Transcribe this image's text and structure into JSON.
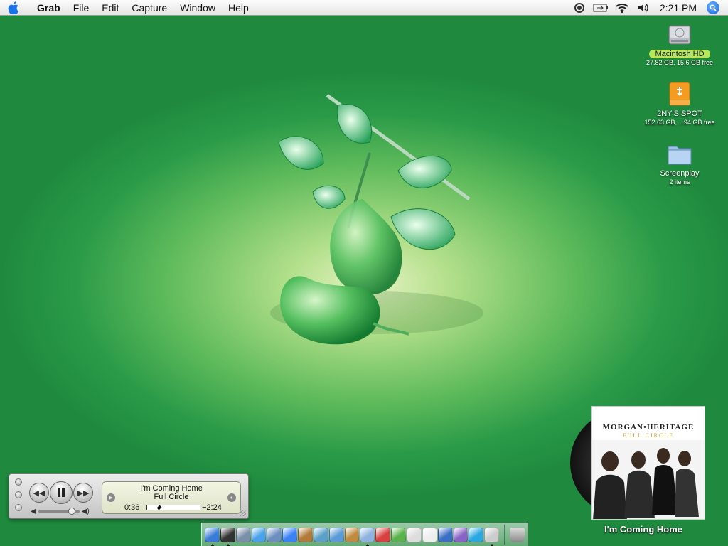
{
  "menubar": {
    "app_name": "Grab",
    "items": [
      "File",
      "Edit",
      "Capture",
      "Window",
      "Help"
    ],
    "clock": "2:21 PM"
  },
  "desktop_icons": [
    {
      "name": "Macintosh HD",
      "sub": "27.82 GB, 15.6 GB free",
      "icon": "hard-drive-icon",
      "selected": true
    },
    {
      "name": "2NY'S SPOT",
      "sub": "152.63 GB, ...94 GB free",
      "icon": "external-drive-icon",
      "selected": false
    },
    {
      "name": "Screenplay",
      "sub": "2 items",
      "icon": "folder-icon",
      "selected": false
    }
  ],
  "itunes": {
    "song": "I'm Coming Home",
    "album": "Full Circle",
    "elapsed": "0:36",
    "remaining": "−2:24",
    "progress": 0.2,
    "volume": 0.85
  },
  "album_art": {
    "band": "MORGAN•HERITAGE",
    "album": "FULL CIRCLE",
    "now_playing": "I'm Coming Home"
  },
  "dock": {
    "apps": [
      {
        "name": "finder-icon",
        "color": "#3a7bd5",
        "running": true
      },
      {
        "name": "dashboard-icon",
        "color": "#333333",
        "running": true
      },
      {
        "name": "system-preferences-icon",
        "color": "#7a8fa8",
        "running": false
      },
      {
        "name": "safari-icon",
        "color": "#4aa3e8",
        "running": false
      },
      {
        "name": "mail-icon",
        "color": "#6d8fc0",
        "running": false
      },
      {
        "name": "ichat-icon",
        "color": "#3b82f6",
        "running": false
      },
      {
        "name": "address-book-icon",
        "color": "#b07a3a",
        "running": false
      },
      {
        "name": "fish-icon",
        "color": "#5aa0c8",
        "running": false
      },
      {
        "name": "itunes-icon",
        "color": "#5b9bd5",
        "running": false
      },
      {
        "name": "garageband-icon",
        "color": "#c08a40",
        "running": false
      },
      {
        "name": "music-note-icon",
        "color": "#8fb3e0",
        "running": true
      },
      {
        "name": "ical-icon",
        "color": "#d94040",
        "running": false
      },
      {
        "name": "adium-duck-icon",
        "color": "#5ab34a",
        "running": false
      },
      {
        "name": "iphoto-icon",
        "color": "#dddddd",
        "running": false
      },
      {
        "name": "dice-icon",
        "color": "#eeeeee",
        "running": false
      },
      {
        "name": "word-icon",
        "color": "#3a6fc4",
        "running": false
      },
      {
        "name": "quicktime-icon",
        "color": "#8a63c6",
        "running": false
      },
      {
        "name": "skype-icon",
        "color": "#2aa8e0",
        "running": false
      },
      {
        "name": "preview-icon",
        "color": "#cccccc",
        "running": true
      }
    ],
    "trash": "trash-icon"
  }
}
